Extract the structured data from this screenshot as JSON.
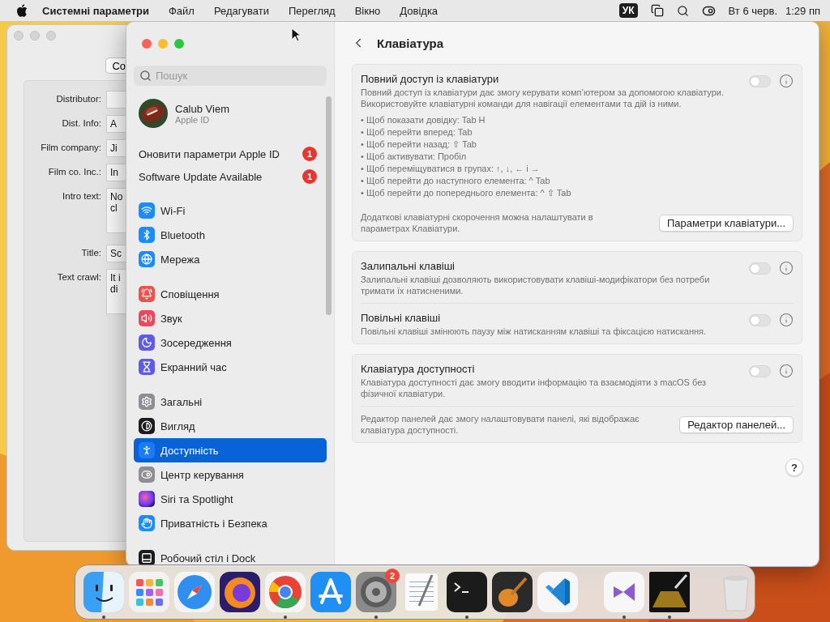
{
  "menu_bar": {
    "app_name": "Системні параметри",
    "menus": [
      "Файл",
      "Редагувати",
      "Перегляд",
      "Вікно",
      "Довідка"
    ],
    "input_source": "УК",
    "date": "Вт 6 черв.",
    "time": "1:29 пп"
  },
  "background_window": {
    "button": "Co",
    "fields": [
      {
        "label": "Distributor:",
        "kind": "single"
      },
      {
        "label": "Dist. Info:",
        "kind": "single",
        "lines": [
          "A"
        ]
      },
      {
        "label": "Film company:",
        "kind": "single",
        "lines": [
          "Ji"
        ]
      },
      {
        "label": "Film co. Inc.:",
        "kind": "single",
        "lines": [
          "In"
        ]
      },
      {
        "label": "Intro text:",
        "kind": "multiline",
        "lines": [
          "No",
          "cl"
        ]
      },
      {
        "label": "Title:",
        "kind": "single",
        "lines": [
          "Sc"
        ]
      },
      {
        "label": "Text crawl:",
        "kind": "multiline",
        "lines": [
          "It i",
          "di"
        ]
      }
    ]
  },
  "sidebar": {
    "search": {
      "placeholder": "Пошук"
    },
    "account": {
      "name": "Calub Viem",
      "subtitle": "Apple ID"
    },
    "alerts": [
      {
        "label": "Оновити параметри Apple ID",
        "badge": "1"
      },
      {
        "label": "Software Update Available",
        "badge": "1"
      }
    ],
    "groups": [
      {
        "items": [
          {
            "label": "Wi-Fi",
            "selected": false
          },
          {
            "label": "Bluetooth",
            "selected": false
          },
          {
            "label": "Мережа",
            "selected": false
          }
        ]
      },
      {
        "items": [
          {
            "label": "Сповіщення",
            "selected": false
          },
          {
            "label": "Звук",
            "selected": false
          },
          {
            "label": "Зосередження",
            "selected": false
          },
          {
            "label": "Екранний час",
            "selected": false
          }
        ]
      },
      {
        "items": [
          {
            "label": "Загальні",
            "selected": false
          },
          {
            "label": "Вигляд",
            "selected": false
          },
          {
            "label": "Доступність",
            "selected": true
          },
          {
            "label": "Центр керування",
            "selected": false
          },
          {
            "label": "Siri та Spotlight",
            "selected": false
          },
          {
            "label": "Приватність і Безпека",
            "selected": false
          }
        ]
      },
      {
        "items": [
          {
            "label": "Робочий стіл і Dock",
            "selected": false
          }
        ]
      }
    ]
  },
  "panel": {
    "title": "Клавіатура",
    "help_button": "?",
    "cards": [
      {
        "rows": [
          {
            "kind": "toggle",
            "title": "Повний доступ із клавіатури",
            "description": "Повний доступ із клавіатури дає змогу керувати комп’ютером за допомогою клавіатури. Використовуйте клавіатурні команди для навігації елементами та дій із ними.",
            "on": false,
            "bullets": [
              "• Щоб показати довідку: Tab H",
              "• Щоб перейти вперед: Tab",
              "• Щоб перейти назад: ⇧ Tab",
              "• Щоб активувати: Пробіл",
              "• Щоб переміщуватися в групах: ↑, ↓, ← і →",
              "• Щоб перейти до наступного елемента: ^ Tab",
              "• Щоб перейти до попереднього елемента: ^ ⇧ Tab"
            ]
          },
          {
            "kind": "action",
            "text": "Додаткові клавіатурні скорочення можна налаштувати в параметрах Клавіатури.",
            "button": "Параметри клавіатури..."
          }
        ]
      },
      {
        "rows": [
          {
            "kind": "toggle",
            "title": "Залипальні клавіші",
            "description": "Залипальні клавіші дозволяють використовувати клавіші-модифікатори без потреби тримати їх натисненими.",
            "on": false
          },
          {
            "kind": "toggle",
            "title": "Повільні клавіші",
            "description": "Повільні клавіші змінюють паузу між натисканням клавіші та фіксацією натискання.",
            "on": false
          }
        ]
      },
      {
        "rows": [
          {
            "kind": "toggle",
            "title": "Клавіатура доступності",
            "description": "Клавіатура доступності дає змогу вводити інформацію та взаємодіяти з macOS без фізичної клавіатури.",
            "on": false
          },
          {
            "kind": "action",
            "text": "Редактор панелей дає змогу налаштовувати панелі, які відображає клавіатура доступності.",
            "button": "Редактор панелей..."
          }
        ]
      }
    ]
  },
  "dock": {
    "sections": [
      {
        "items": [
          {
            "running": true
          },
          {
            "running": false
          },
          {
            "running": false
          },
          {
            "running": false
          },
          {
            "running": true
          },
          {
            "running": false
          },
          {
            "running": true,
            "badge": "2"
          },
          {
            "running": false
          },
          {
            "running": true
          },
          {
            "running": false
          },
          {
            "running": false
          }
        ]
      },
      {
        "items": [
          {
            "running": true
          },
          {
            "running": true
          }
        ]
      },
      {
        "items": [
          {
            "running": false
          }
        ]
      }
    ]
  }
}
